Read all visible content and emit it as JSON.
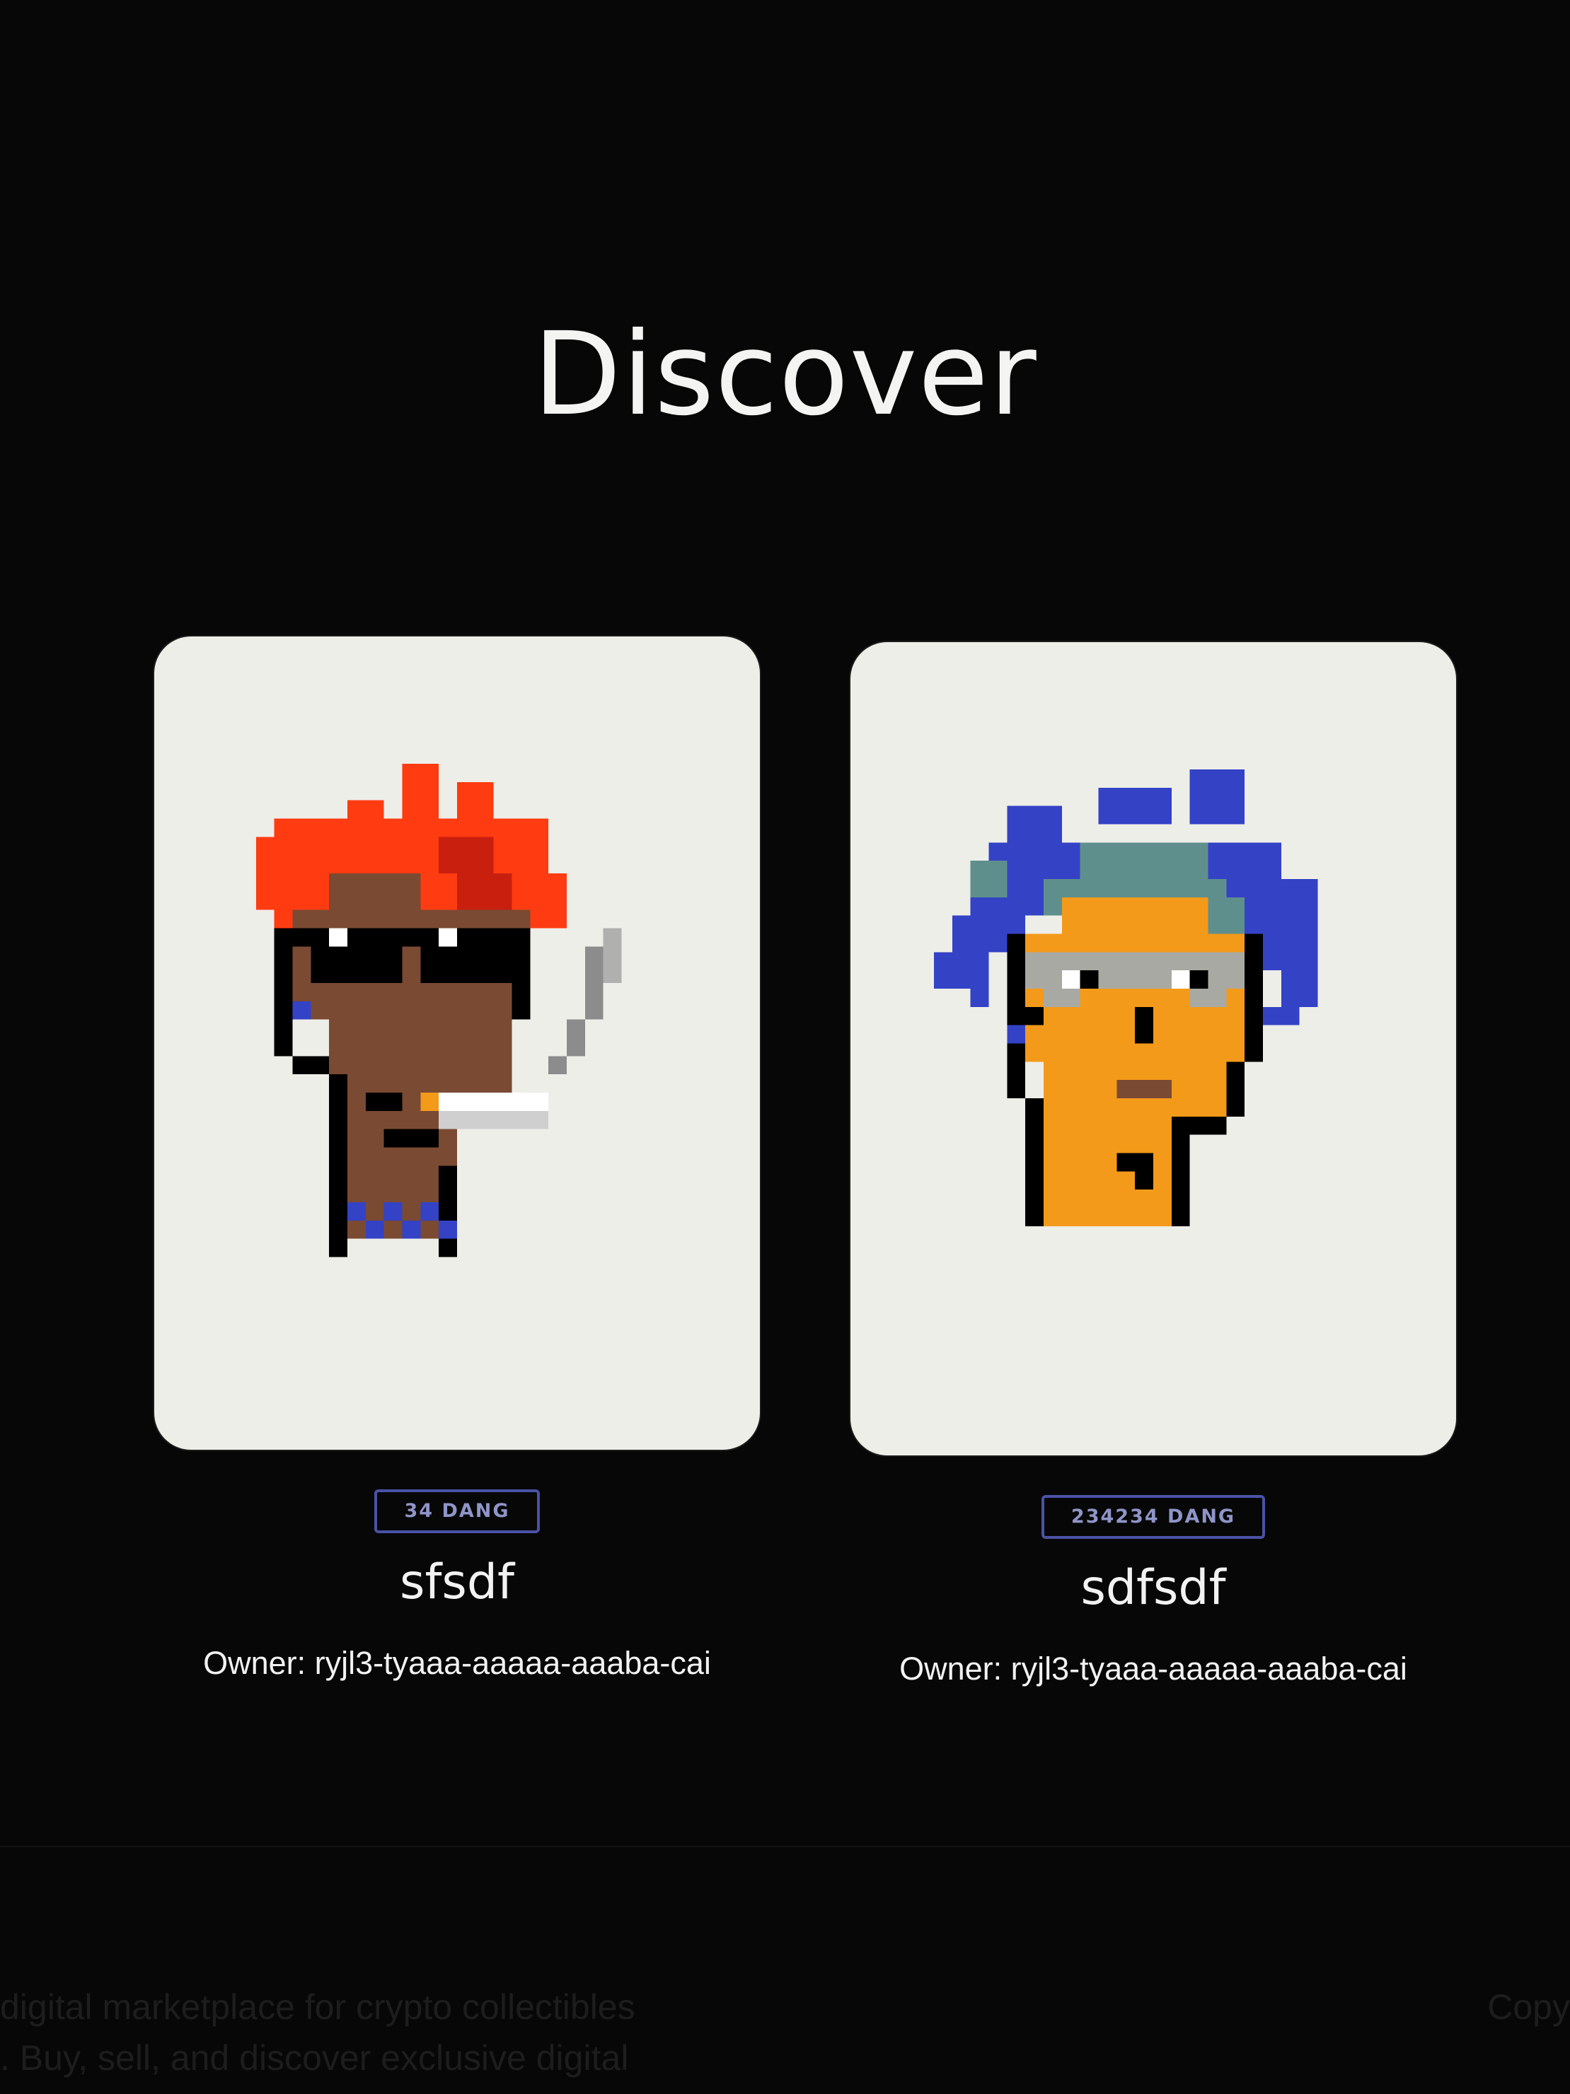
{
  "page": {
    "title": "Discover"
  },
  "cards": [
    {
      "price": "34 DANG",
      "name": "sfsdf",
      "owner": "Owner: ryjl3-tyaaa-aaaaa-aaaba-cai"
    },
    {
      "price": "234234 DANG",
      "name": "sdfsdf",
      "owner": "Owner: ryjl3-tyaaa-aaaaa-aaaba-cai"
    }
  ],
  "footer": {
    "tagline_line1": "digital marketplace for crypto collectibles",
    "tagline_line2": ". Buy, sell, and discover exclusive digital",
    "copyright": "Copy"
  },
  "icons": {
    "card1_art": "pixel-punk-red-hair-smoking-icon",
    "card2_art": "pixel-punk-blue-hair-icon"
  },
  "colors": {
    "background": "#070707",
    "card_background": "#eeeee8",
    "badge_border": "#4a52a6",
    "badge_text": "#8f95c8",
    "red_hair": "#ff3b12",
    "blue_hair": "#3442c6",
    "skin_brown": "#7a4a32",
    "skin_orange": "#f39a1a"
  }
}
